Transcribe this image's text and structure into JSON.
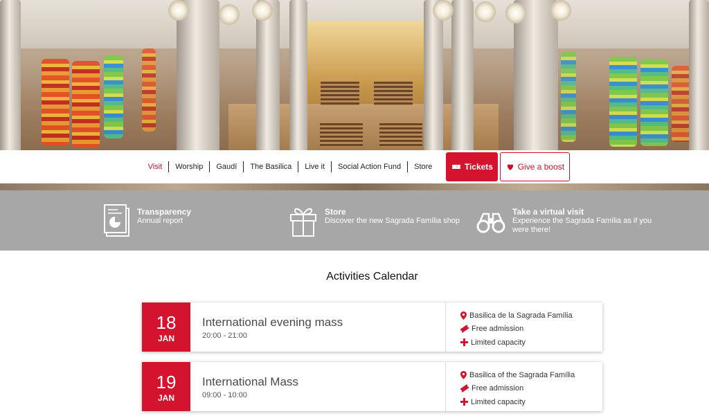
{
  "nav": {
    "items": [
      "Visit",
      "Worship",
      "Gaudí",
      "The Basilica",
      "Live it",
      "Social Action Fund",
      "Store"
    ],
    "tickets_label": "Tickets",
    "boost_label": "Give a boost",
    "accent_color": "#d4132e"
  },
  "band": {
    "items": [
      {
        "title": "Transparency",
        "subtitle": "Annual report",
        "icon": "report-document-icon"
      },
      {
        "title": "Store",
        "subtitle": "Discover the new Sagrada Família shop",
        "icon": "gift-box-icon"
      },
      {
        "title": "Take a virtual visit",
        "subtitle": "Experience the Sagrada Família as if you were there!",
        "icon": "binoculars-icon"
      }
    ]
  },
  "calendar": {
    "title": "Activities Calendar",
    "events": [
      {
        "day": "18",
        "month": "JAN",
        "title": "International evening mass",
        "time": "20:00 - 21:00",
        "location": "Basilica de la Sagrada Família",
        "admission": "Free admission",
        "capacity": "Limited capacity"
      },
      {
        "day": "19",
        "month": "JAN",
        "title": "International Mass",
        "time": "09:00 - 10:00",
        "location": "Basilica of the Sagrada Família",
        "admission": "Free admission",
        "capacity": "Limited capacity"
      }
    ]
  }
}
